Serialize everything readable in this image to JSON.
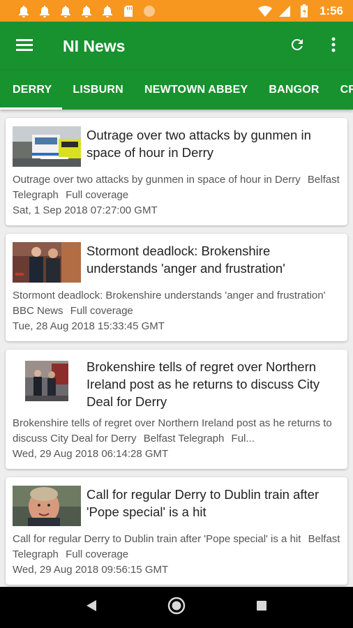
{
  "status_bar": {
    "time": "1:56",
    "background": "#f7971f"
  },
  "app_bar": {
    "title": "NI News",
    "background": "#18922f",
    "menu_icon": "hamburger-icon",
    "refresh_icon": "refresh-icon",
    "overflow_icon": "more-vert-icon"
  },
  "tabs": [
    {
      "label": "DERRY",
      "active": true
    },
    {
      "label": "LISBURN",
      "active": false
    },
    {
      "label": "NEWTOWN ABBEY",
      "active": false
    },
    {
      "label": "BANGOR",
      "active": false
    },
    {
      "label": "CRA",
      "active": false
    }
  ],
  "articles": [
    {
      "title": "Outrage over two attacks by gunmen in space of hour in Derry",
      "description": "Outrage over two attacks by gunmen in space of hour in Derry",
      "source": "Belfast Telegraph",
      "coverage": "Full coverage",
      "date": "Sat, 1 Sep 2018 07:27:00 GMT"
    },
    {
      "title": "Stormont deadlock: Brokenshire understands 'anger and frustration'",
      "description": "Stormont deadlock: Brokenshire understands 'anger and frustration'",
      "source": "BBC News",
      "coverage": "Full coverage",
      "date": "Tue, 28 Aug 2018 15:33:45 GMT"
    },
    {
      "title": "Brokenshire tells of regret over Northern Ireland post as he returns to discuss City Deal for Derry",
      "description": "Brokenshire tells of regret over Northern Ireland post as he returns to discuss City Deal for Derry",
      "source": "Belfast Telegraph",
      "coverage": "Ful...",
      "date": "Wed, 29 Aug 2018 06:14:28 GMT"
    },
    {
      "title": "Call for regular Derry to Dublin train after 'Pope special' is a hit",
      "description": "Call for regular Derry to Dublin train after 'Pope special' is a hit",
      "source": "Belfast Telegraph",
      "coverage": "Full coverage",
      "date": "Wed, 29 Aug 2018 09:56:15 GMT"
    }
  ]
}
